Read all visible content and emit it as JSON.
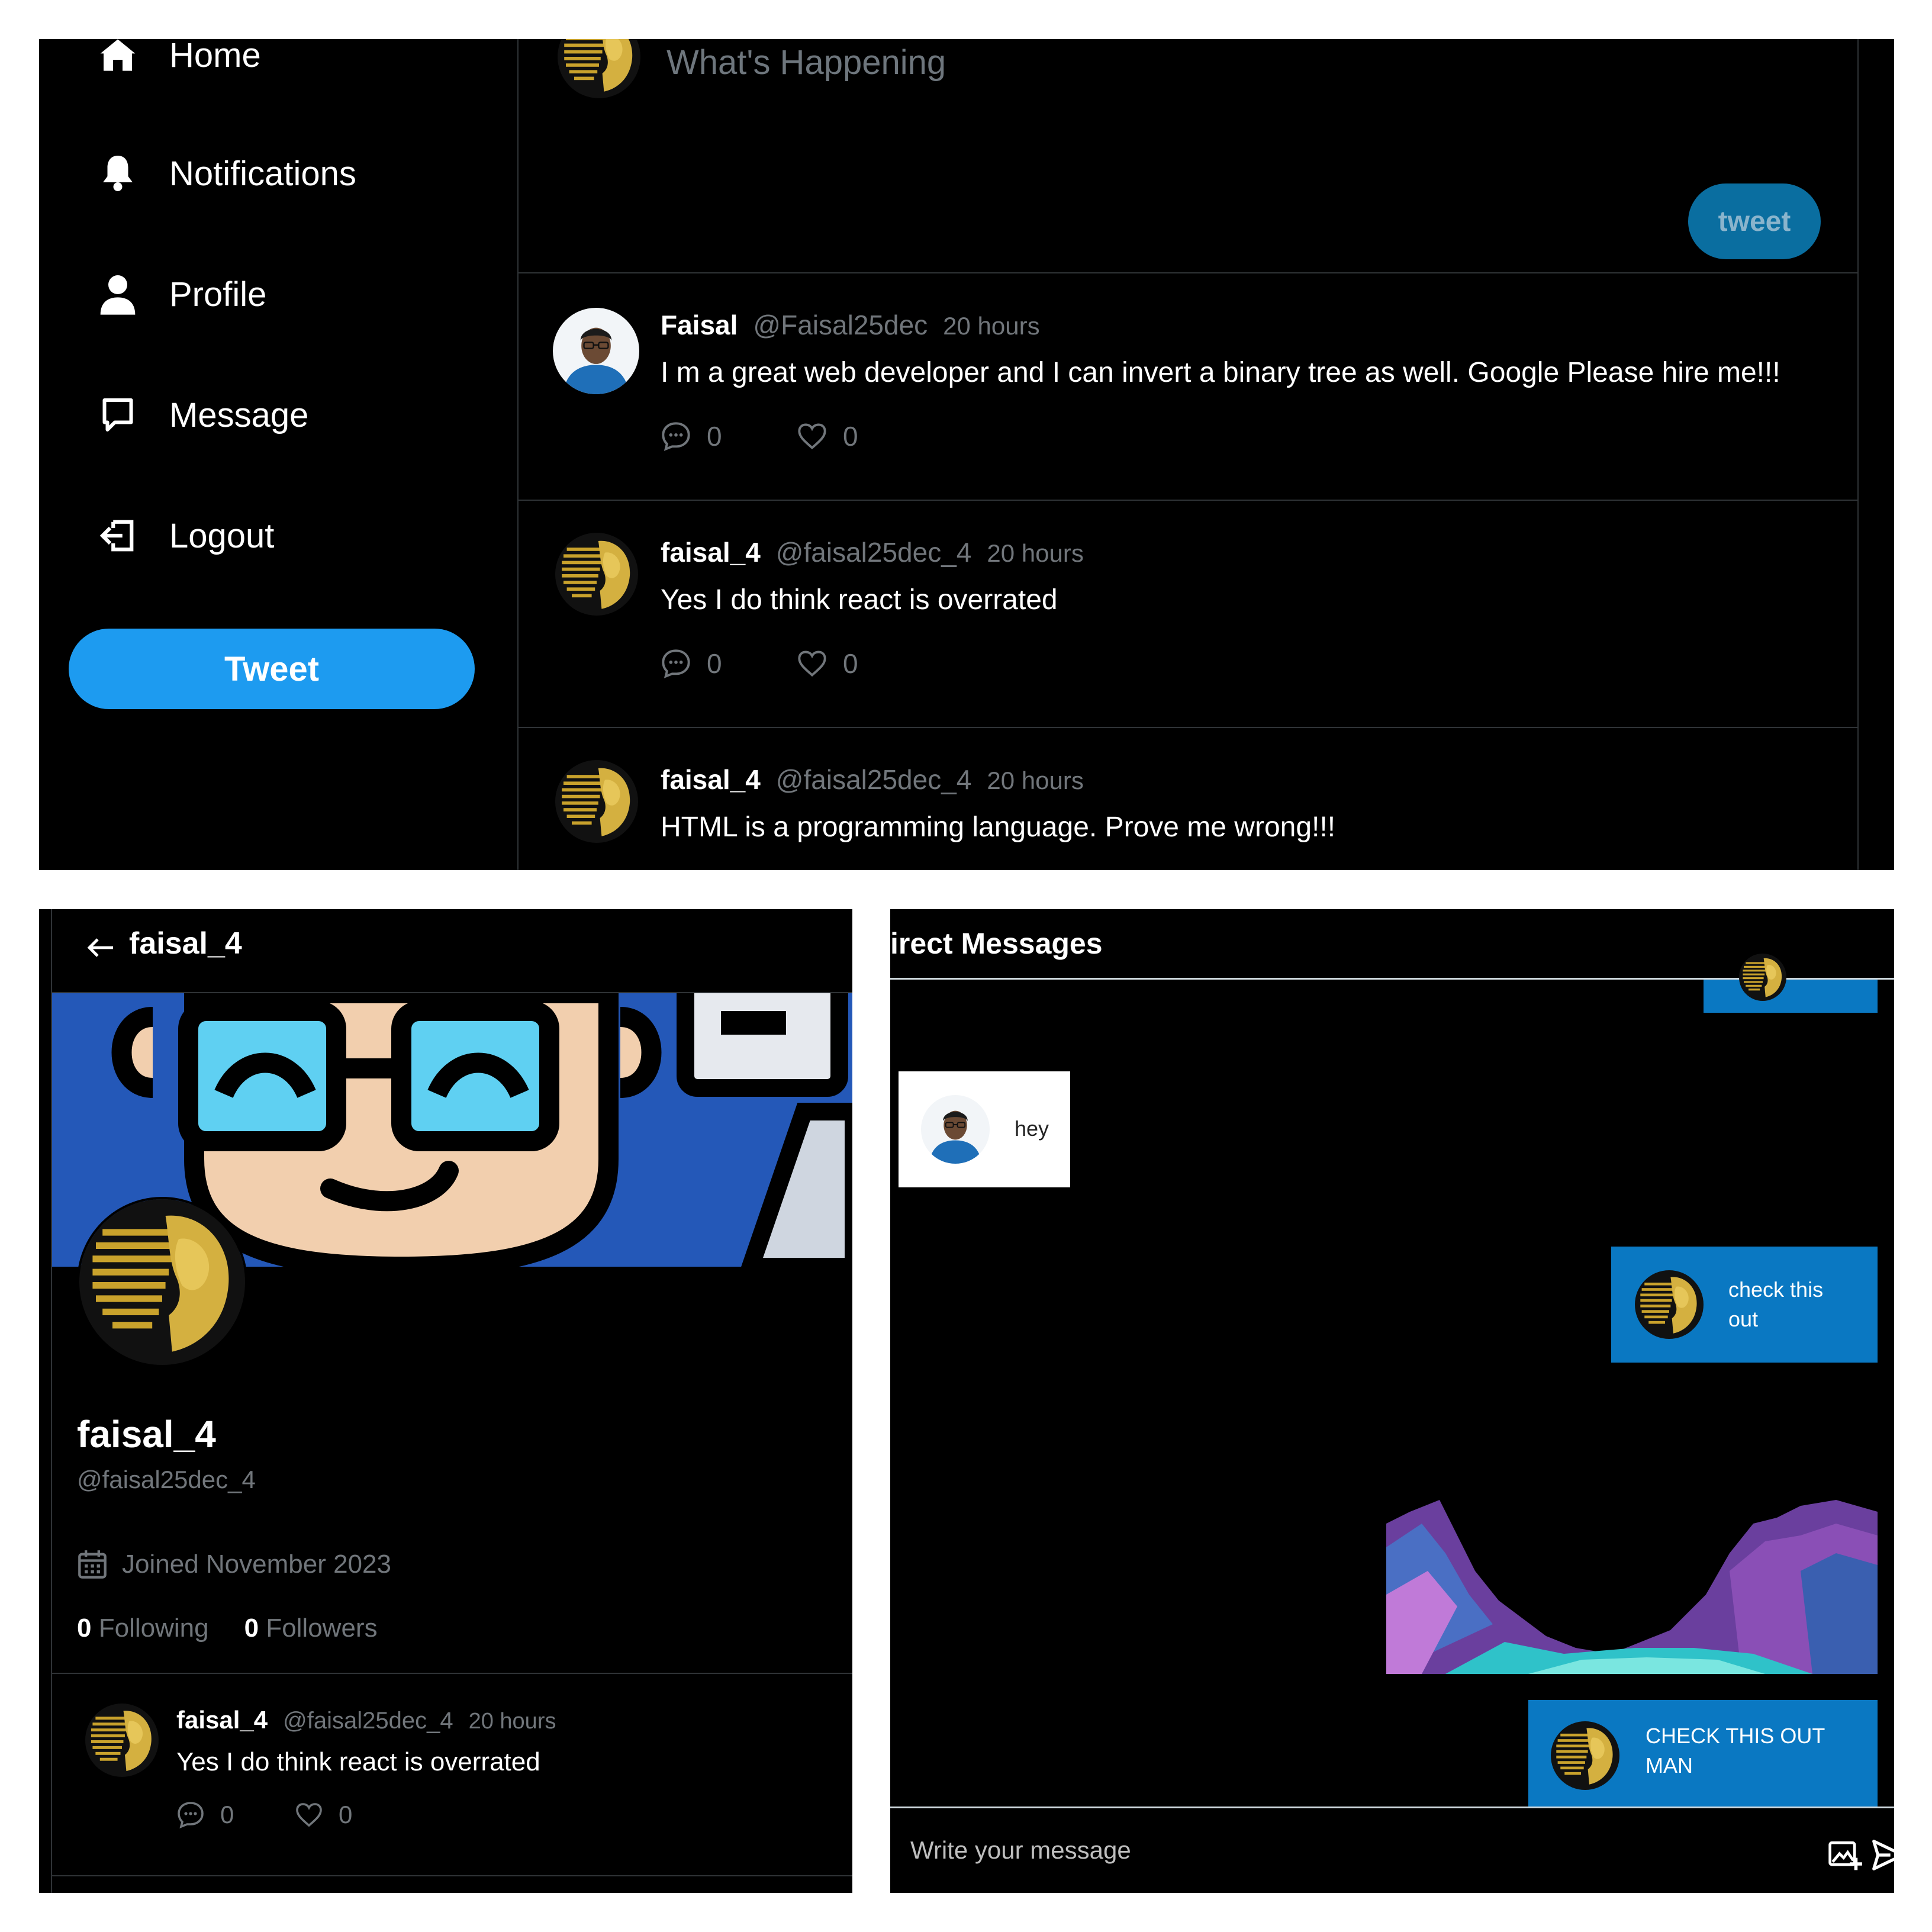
{
  "sidebar": {
    "items": [
      {
        "label": "Home",
        "icon": "home-icon"
      },
      {
        "label": "Notifications",
        "icon": "bell-icon"
      },
      {
        "label": "Profile",
        "icon": "person-icon"
      },
      {
        "label": "Message",
        "icon": "message-icon"
      },
      {
        "label": "Logout",
        "icon": "logout-icon"
      }
    ],
    "tweet_button": "Tweet"
  },
  "composer": {
    "placeholder": "What's Happening",
    "button": "tweet"
  },
  "feed": [
    {
      "name": "Faisal",
      "handle": "@Faisal25dec",
      "time": "20 hours",
      "text": "I m a great web developer and I can invert a binary tree as well. Google Please hire me!!!",
      "comments": "0",
      "likes": "0"
    },
    {
      "name": "faisal_4",
      "handle": "@faisal25dec_4",
      "time": "20 hours",
      "text": "Yes I do think react is overrated",
      "comments": "0",
      "likes": "0"
    },
    {
      "name": "faisal_4",
      "handle": "@faisal25dec_4",
      "time": "20 hours",
      "text": "HTML is a programming language. Prove me wrong!!!"
    }
  ],
  "profile": {
    "header_title": "faisal_4",
    "name": "faisal_4",
    "handle": "@faisal25dec_4",
    "joined": "Joined November 2023",
    "following_count": "0",
    "following_label": "Following",
    "followers_count": "0",
    "followers_label": "Followers",
    "post": {
      "name": "faisal_4",
      "handle": "@faisal25dec_4",
      "time": "20 hours",
      "text": "Yes I do think react is overrated",
      "comments": "0",
      "likes": "0"
    }
  },
  "dm": {
    "title": "irect Messages",
    "messages": [
      {
        "side": "left",
        "text": "hey"
      },
      {
        "side": "right",
        "text": "check this out"
      },
      {
        "side": "right",
        "type": "image"
      },
      {
        "side": "right",
        "text": "CHECK THIS OUT MAN"
      }
    ],
    "input_placeholder": "Write your message"
  },
  "colors": {
    "accent": "#1d9bf0",
    "bubble_blue": "#0a78c2",
    "background": "#000000",
    "muted_text": "#71767b"
  }
}
